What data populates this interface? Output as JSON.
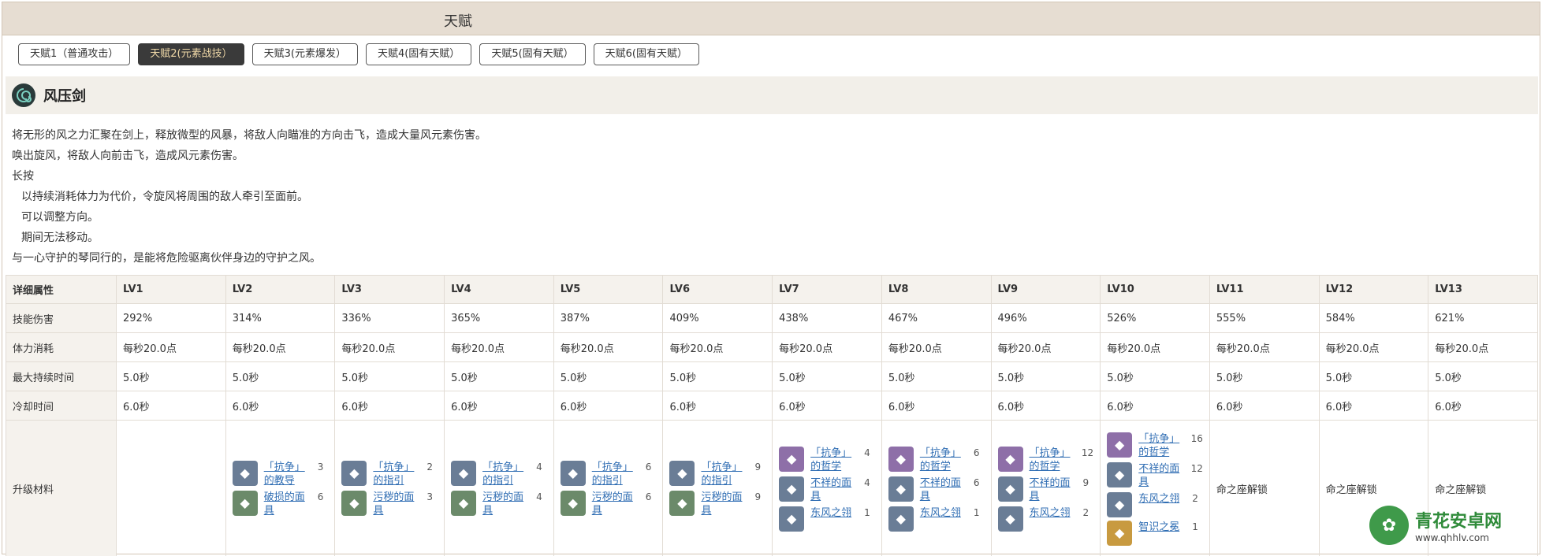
{
  "title": "天赋",
  "tabs": [
    "天赋1（普通攻击）",
    "天赋2(元素战技）",
    "天赋3(元素爆发）",
    "天赋4(固有天赋）",
    "天赋5(固有天赋）",
    "天赋6(固有天赋）"
  ],
  "skill": {
    "name": "风压剑"
  },
  "desc": [
    "将无形的风之力汇聚在剑上，释放微型的风暴，将敌人向瞄准的方向击飞，造成大量风元素伤害。",
    "唤出旋风，将敌人向前击飞，造成风元素伤害。",
    "长按",
    "以持续消耗体力为代价，令旋风将周围的敌人牵引至面前。",
    "可以调整方向。",
    "期间无法移动。",
    "与一心守护的琴同行的，是能将危险驱离伙伴身边的守护之风。"
  ],
  "table": {
    "header": [
      "详细属性",
      "LV1",
      "LV2",
      "LV3",
      "LV4",
      "LV5",
      "LV6",
      "LV7",
      "LV8",
      "LV9",
      "LV10",
      "LV11",
      "LV12",
      "LV13"
    ],
    "rows": [
      [
        "技能伤害",
        "292%",
        "314%",
        "336%",
        "365%",
        "387%",
        "409%",
        "438%",
        "467%",
        "496%",
        "526%",
        "555%",
        "584%",
        "621%"
      ],
      [
        "体力消耗",
        "每秒20.0点",
        "每秒20.0点",
        "每秒20.0点",
        "每秒20.0点",
        "每秒20.0点",
        "每秒20.0点",
        "每秒20.0点",
        "每秒20.0点",
        "每秒20.0点",
        "每秒20.0点",
        "每秒20.0点",
        "每秒20.0点",
        "每秒20.0点"
      ],
      [
        "最大持续时间",
        "5.0秒",
        "5.0秒",
        "5.0秒",
        "5.0秒",
        "5.0秒",
        "5.0秒",
        "5.0秒",
        "5.0秒",
        "5.0秒",
        "5.0秒",
        "5.0秒",
        "5.0秒",
        "5.0秒"
      ],
      [
        "冷却时间",
        "6.0秒",
        "6.0秒",
        "6.0秒",
        "6.0秒",
        "6.0秒",
        "6.0秒",
        "6.0秒",
        "6.0秒",
        "6.0秒",
        "6.0秒",
        "6.0秒",
        "6.0秒",
        "6.0秒"
      ]
    ],
    "mat_label": "升级材料",
    "unlock": "命之座解锁",
    "mats": [
      [],
      [
        {
          "name": "「抗争」的教导",
          "count": "3",
          "c": "blue"
        },
        {
          "name": "破损的面具",
          "count": "6",
          "c": "green"
        }
      ],
      [
        {
          "name": "「抗争」的指引",
          "count": "2",
          "c": "blue"
        },
        {
          "name": "污秽的面具",
          "count": "3",
          "c": "green"
        }
      ],
      [
        {
          "name": "「抗争」的指引",
          "count": "4",
          "c": "blue"
        },
        {
          "name": "污秽的面具",
          "count": "4",
          "c": "green"
        }
      ],
      [
        {
          "name": "「抗争」的指引",
          "count": "6",
          "c": "blue"
        },
        {
          "name": "污秽的面具",
          "count": "6",
          "c": "green"
        }
      ],
      [
        {
          "name": "「抗争」的指引",
          "count": "9",
          "c": "blue"
        },
        {
          "name": "污秽的面具",
          "count": "9",
          "c": "green"
        }
      ],
      [
        {
          "name": "「抗争」的哲学",
          "count": "4",
          "c": "purple"
        },
        {
          "name": "不祥的面具",
          "count": "4",
          "c": "blue"
        },
        {
          "name": "东风之翎",
          "count": "1",
          "c": "blue"
        }
      ],
      [
        {
          "name": "「抗争」的哲学",
          "count": "6",
          "c": "purple"
        },
        {
          "name": "不祥的面具",
          "count": "6",
          "c": "blue"
        },
        {
          "name": "东风之翎",
          "count": "1",
          "c": "blue"
        }
      ],
      [
        {
          "name": "「抗争」的哲学",
          "count": "12",
          "c": "purple"
        },
        {
          "name": "不祥的面具",
          "count": "9",
          "c": "blue"
        },
        {
          "name": "东风之翎",
          "count": "2",
          "c": "blue"
        }
      ],
      [
        {
          "name": "「抗争」的哲学",
          "count": "16",
          "c": "purple"
        },
        {
          "name": "不祥的面具",
          "count": "12",
          "c": "blue"
        },
        {
          "name": "东风之翎",
          "count": "2",
          "c": "blue"
        },
        {
          "name": "智识之冕",
          "count": "1",
          "c": "gold"
        }
      ]
    ]
  },
  "watermark": {
    "name": "青花安卓网",
    "url": "www.qhhlv.com"
  }
}
